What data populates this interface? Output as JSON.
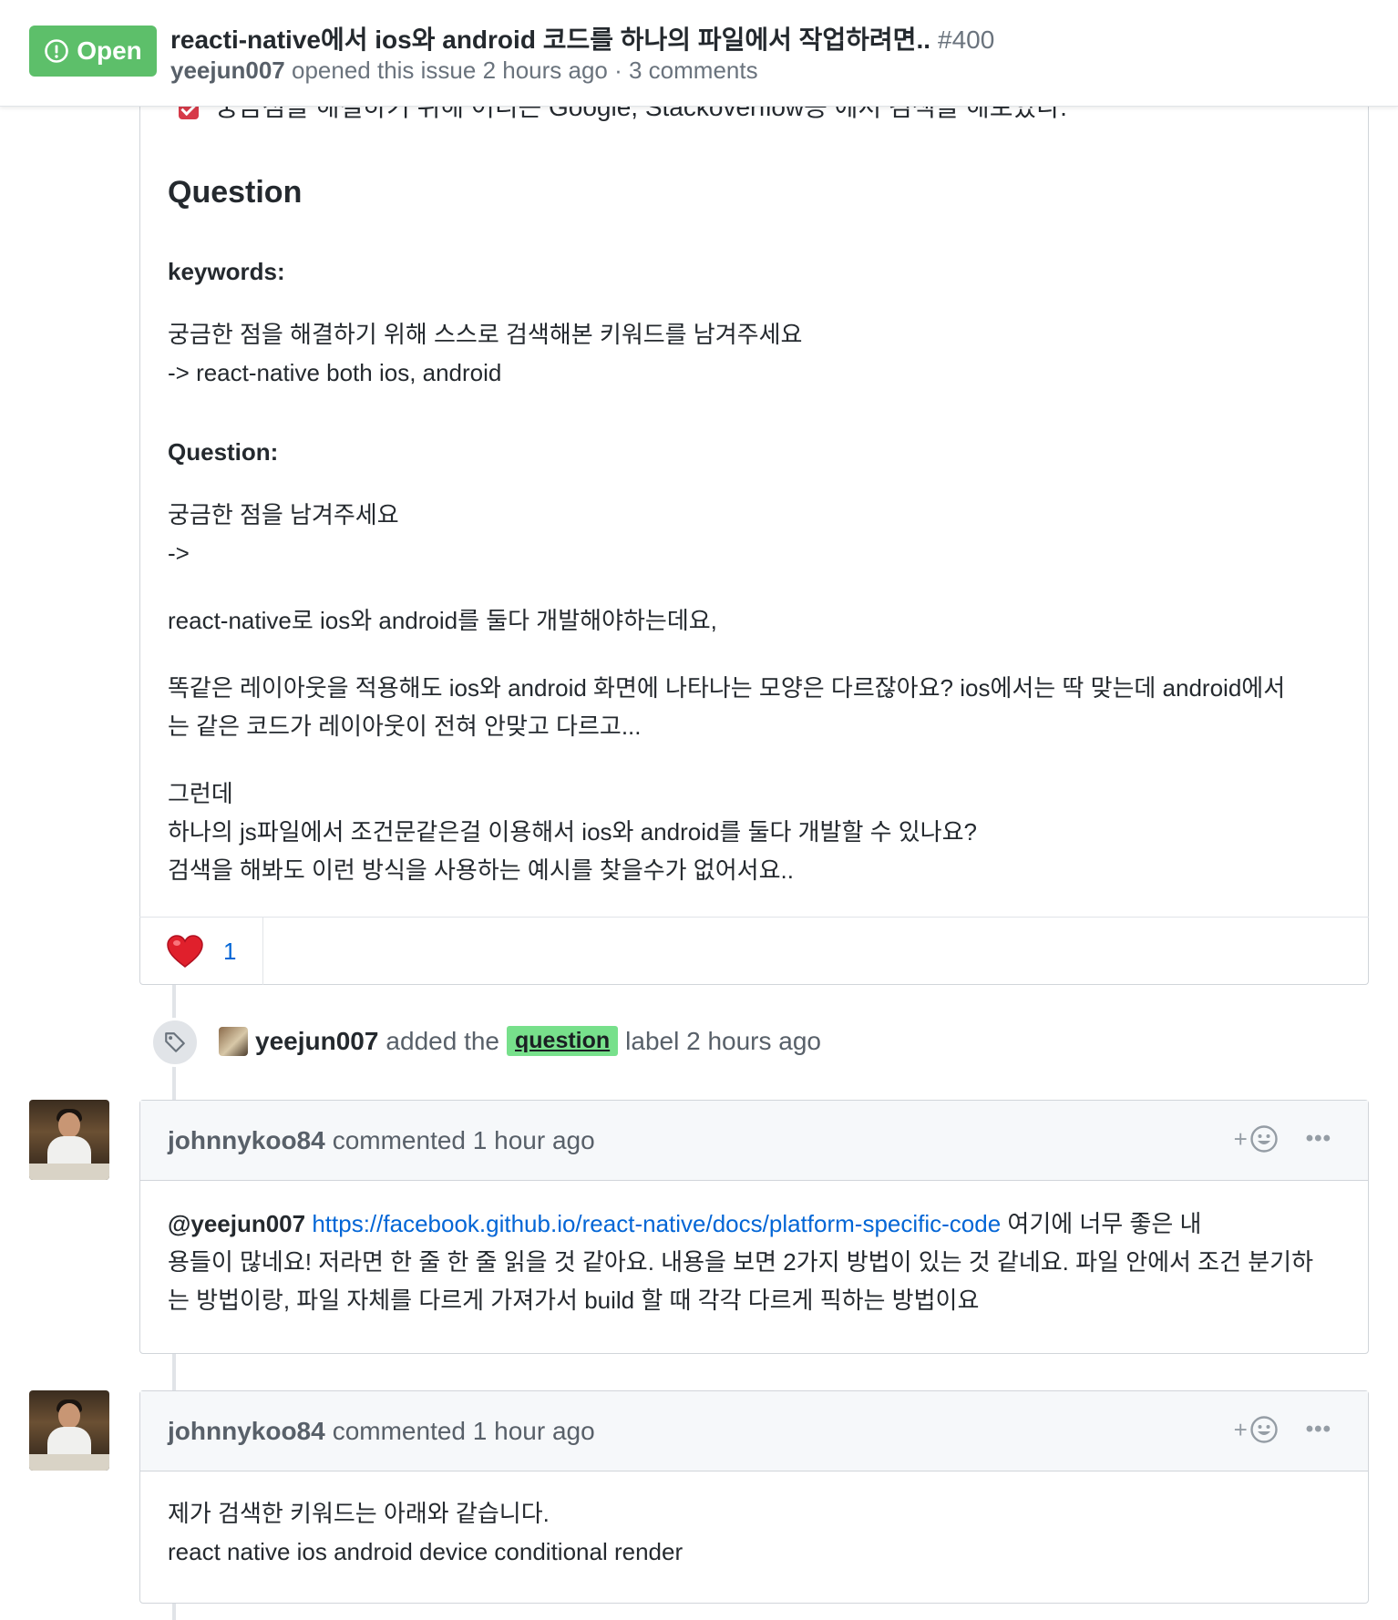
{
  "header": {
    "state": "Open",
    "title": "reacti-native에서 ios와 android 코드를 하나의 파일에서 작업하려면..",
    "number": "#400",
    "author": "yeejun007",
    "meta_rest": "opened this issue 2 hours ago · 3 comments"
  },
  "body": {
    "cut_line": "궁금점을 해결하기 위해 어디든 Google, Stackoverflow등 에서 검색을 해보았다.",
    "heading": "Question",
    "keywords_label": "keywords:",
    "keywords_line1": "궁금한 점을 해결하기 위해 스스로 검색해본 키워드를 남겨주세요",
    "keywords_line2": "-> react-native both ios, android",
    "question_label": "Question:",
    "question_line1": "궁금한 점을 남겨주세요",
    "question_line2": "->",
    "paragraph1": "react-native로 ios와 android를 둘다 개발해야하는데요,",
    "paragraph2_line1": "똑같은 레이아웃을 적용해도 ios와 android 화면에 나타나는 모양은 다르잖아요? ios에서는 딱 맞는데 android에서",
    "paragraph2_line2": "는 같은 코드가 레이아웃이 전혀 안맞고 다르고...",
    "paragraph3_line1": "그런데",
    "paragraph3_line2": "하나의 js파일에서 조건문같은걸 이용해서 ios와 android를 둘다 개발할 수 있나요?",
    "paragraph3_line3": "검색을 해봐도 이런 방식을 사용하는 예시를 찾을수가 없어서요..",
    "reaction_emoji": "❤️",
    "reaction_count": "1"
  },
  "label_event": {
    "icon": "tag-icon",
    "actor": "yeejun007",
    "action": "added the",
    "label": "question",
    "suffix": "label 2 hours ago",
    "label_color": "#77e08b"
  },
  "comments": [
    {
      "author": "johnnykoo84",
      "meta": "commented 1 hour ago",
      "mention": "@yeejun007",
      "link": "https://facebook.github.io/react-native/docs/platform-specific-code",
      "line1_rest": "여기에 너무 좋은 내",
      "line2": "용들이 많네요! 저라면 한 줄 한 줄 읽을 것 같아요. 내용을 보면 2가지 방법이 있는 것 같네요. 파일 안에서 조건 분기하",
      "line3": "는 방법이랑, 파일 자체를 다르게 가져가서 build 할 때 각각 다르게 픽하는 방법이요"
    },
    {
      "author": "johnnykoo84",
      "meta": "commented 1 hour ago",
      "line1": "제가 검색한 키워드는 아래와 같습니다.",
      "line2": "react native ios android device conditional render"
    }
  ],
  "actions": {
    "add_reaction": "+",
    "more": "•••"
  },
  "colors": {
    "open_green": "#5dbf6a",
    "link_blue": "#0366d6",
    "muted": "#586069"
  }
}
